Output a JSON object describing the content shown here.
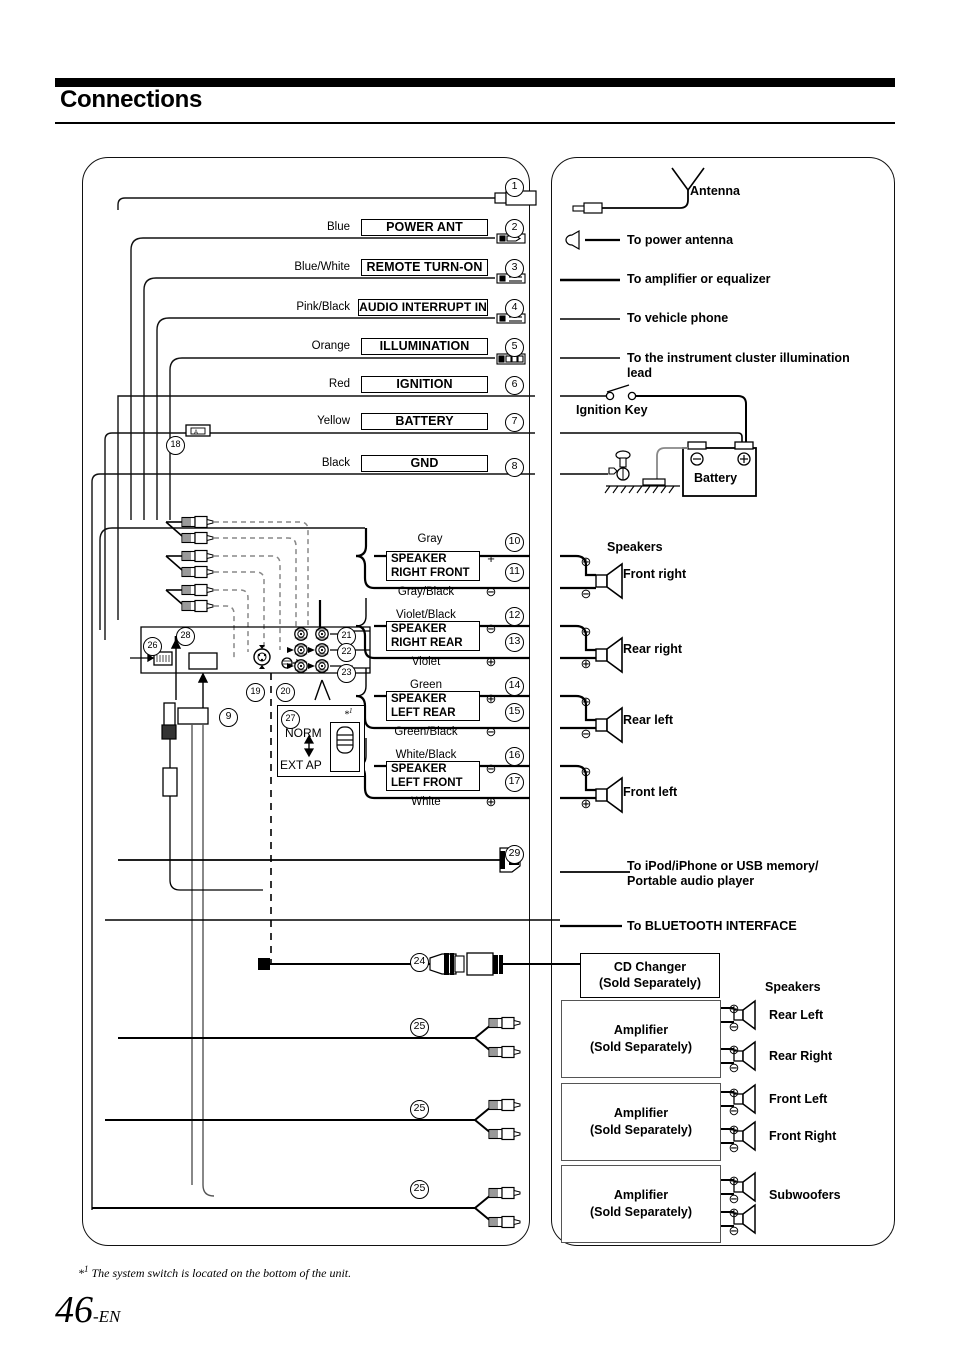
{
  "header": {
    "title": "Connections"
  },
  "footnote": {
    "marker": "*1",
    "text": "The system switch is located on the bottom of the unit."
  },
  "page": {
    "number": "46",
    "suffix": "-EN"
  },
  "left_panel": {
    "power_wires": [
      {
        "id": "1",
        "color": "",
        "label": ""
      },
      {
        "id": "2",
        "color": "Blue",
        "label": "POWER ANT"
      },
      {
        "id": "3",
        "color": "Blue/White",
        "label": "REMOTE TURN-ON"
      },
      {
        "id": "4",
        "color": "Pink/Black",
        "label": "AUDIO INTERRUPT IN"
      },
      {
        "id": "5",
        "color": "Orange",
        "label": "ILLUMINATION"
      },
      {
        "id": "6",
        "color": "Red",
        "label": "IGNITION"
      },
      {
        "id": "7",
        "color": "Yellow",
        "label": "BATTERY"
      },
      {
        "id": "8",
        "color": "Black",
        "label": "GND"
      }
    ],
    "fuse_callout": "18",
    "speakers": [
      {
        "top_color": "Gray",
        "top_id": "10",
        "name_line1": "SPEAKER",
        "name_line2": "RIGHT FRONT",
        "top_sign": "+",
        "bot_sign": "-",
        "bot_color": "Gray/Black",
        "bot_id": "11"
      },
      {
        "top_color": "Violet/Black",
        "top_id": "12",
        "name_line1": "SPEAKER",
        "name_line2": "RIGHT REAR",
        "top_sign": "-",
        "bot_sign": "+",
        "bot_color": "Violet",
        "bot_id": "13"
      },
      {
        "top_color": "Green",
        "top_id": "14",
        "name_line1": "SPEAKER",
        "name_line2": "LEFT REAR",
        "top_sign": "+",
        "bot_sign": "-",
        "bot_color": "Green/Black",
        "bot_id": "15"
      },
      {
        "top_color": "White/Black",
        "top_id": "16",
        "name_line1": "SPEAKER",
        "name_line2": "LEFT FRONT",
        "top_sign": "-",
        "bot_sign": "+",
        "bot_color": "White",
        "bot_id": "17"
      }
    ],
    "rca_callouts": [
      "21",
      "22",
      "23"
    ],
    "misc_callouts": {
      "c9": "9",
      "c19": "19",
      "c20": "20",
      "c26": "26",
      "c27": "27",
      "c28": "28",
      "c29": "29",
      "c24": "24",
      "c25a": "25",
      "c25b": "25",
      "c25c": "25"
    },
    "system_switch": {
      "callout": "27",
      "top_label": "NORM",
      "bottom_label": "EXT AP",
      "note_marker": "*1"
    }
  },
  "right_panel": {
    "antenna_label": "Antenna",
    "leads": [
      "To power antenna",
      "To amplifier or equalizer",
      "To vehicle phone",
      "To the instrument cluster illumination lead"
    ],
    "instrument_lead_line1": "To the instrument cluster illumination",
    "instrument_lead_line2": "lead",
    "ignition_key": "Ignition Key",
    "battery": "Battery",
    "battery_minus": "-",
    "battery_plus": "+",
    "speakers_heading": "Speakers",
    "speakers": [
      {
        "label": "Front right",
        "top_sign": "+",
        "bot_sign": "-"
      },
      {
        "label": "Rear right",
        "top_sign": "-",
        "bot_sign": "+"
      },
      {
        "label": "Rear left",
        "top_sign": "+",
        "bot_sign": "-"
      },
      {
        "label": "Front left",
        "top_sign": "-",
        "bot_sign": "+"
      }
    ],
    "ipod_line1": "To iPod/iPhone or USB memory/",
    "ipod_line2": "Portable audio player",
    "bluetooth": "To BLUETOOTH INTERFACE",
    "cd_changer_line1": "CD Changer",
    "cd_changer_line2": "(Sold Separately)",
    "amp_line1": "Amplifier",
    "amp_line2": "(Sold Separately)",
    "speakers_heading2": "Speakers",
    "amp_speakers": [
      "Rear Left",
      "Rear Right",
      "Front Left",
      "Front Right",
      "Subwoofers"
    ]
  },
  "colors": {
    "ink": "#000000",
    "grey_line": "#555555",
    "paper": "#ffffff"
  }
}
